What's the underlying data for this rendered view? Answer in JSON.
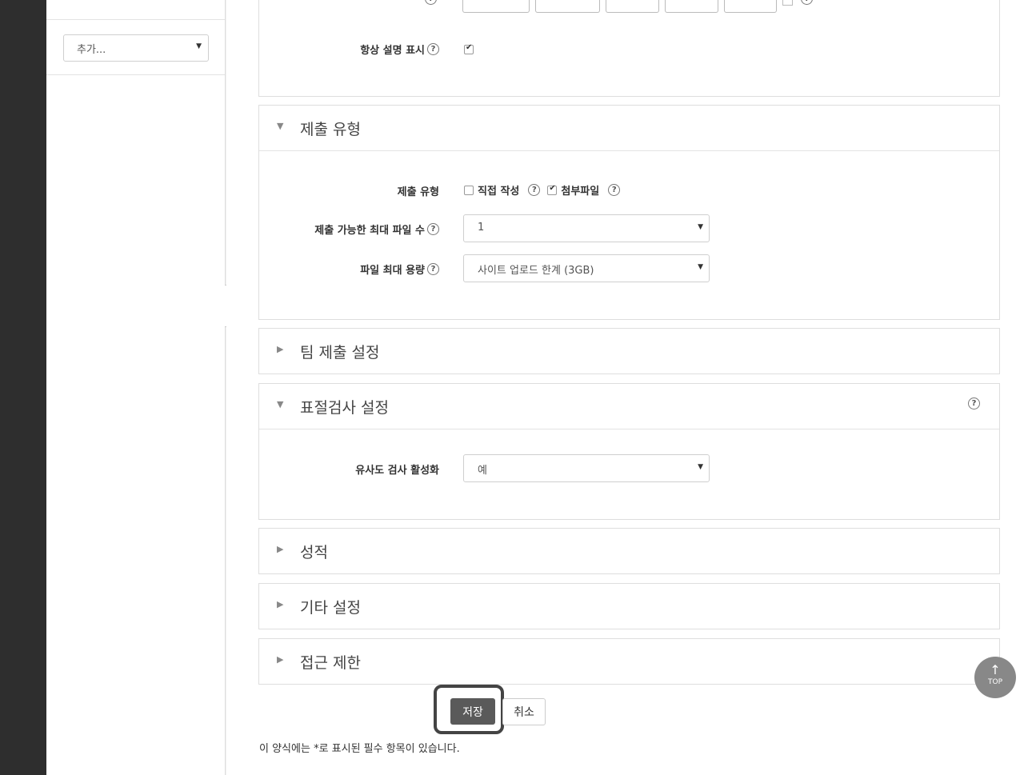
{
  "sidebar": {
    "add_select": "추가..."
  },
  "sections": {
    "appearance": {
      "always_show_description_label": "항상 설명 표시",
      "always_show_description_checked": true
    },
    "submission_types": {
      "title": "제출 유형",
      "expanded": true,
      "type_label": "제출 유형",
      "online_text_label": "직접 작성",
      "online_text_checked": false,
      "file_label": "첨부파일",
      "file_checked": true,
      "max_files_label": "제출 가능한 최대 파일 수",
      "max_files_value": "1",
      "max_size_label": "파일 최대 용량",
      "max_size_value": "사이트 업로드 한계 (3GB)"
    },
    "team": {
      "title": "팀 제출 설정",
      "expanded": false
    },
    "plagiarism": {
      "title": "표절검사 설정",
      "expanded": true,
      "similarity_label": "유사도 검사 활성화",
      "similarity_value": "예"
    },
    "grade": {
      "title": "성적",
      "expanded": false
    },
    "other": {
      "title": "기타 설정",
      "expanded": false
    },
    "access": {
      "title": "접근 제한",
      "expanded": false
    }
  },
  "buttons": {
    "save": "저장",
    "cancel": "취소"
  },
  "required_note": "이 양식에는 *로 표시된 필수 항목이 있습니다.",
  "top_button": {
    "arrow": "↑",
    "label": "TOP"
  },
  "icons": {
    "help": "question-circle",
    "caret": "▼",
    "expanded": "▼",
    "collapsed": "▶",
    "collapse_sidebar": "◀"
  }
}
